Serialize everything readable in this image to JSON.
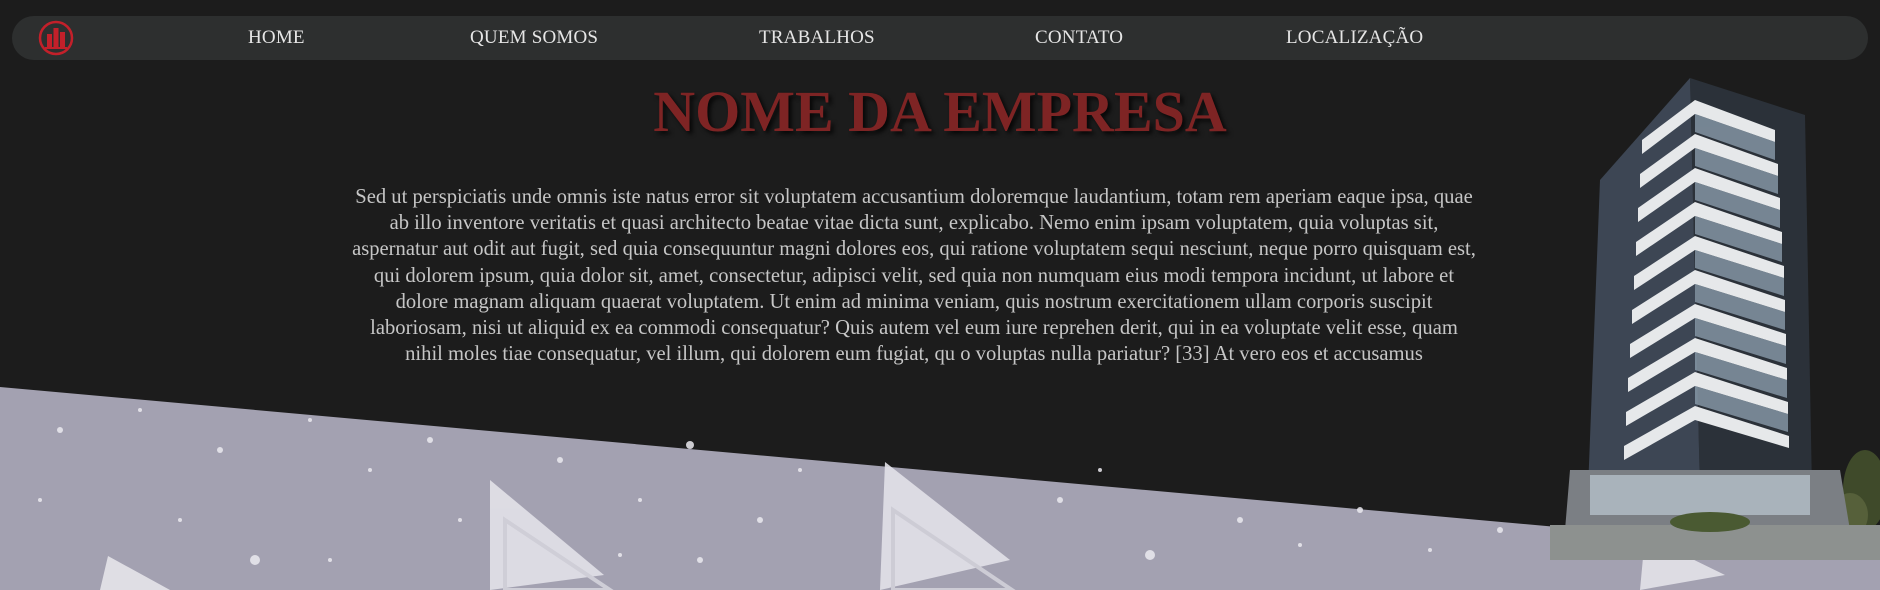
{
  "nav": {
    "logo_icon": "company-logo-icon",
    "items": [
      {
        "label": "HOME"
      },
      {
        "label": "QUEM SOMOS"
      },
      {
        "label": "TRABALHOS"
      },
      {
        "label": "CONTATO"
      },
      {
        "label": "LOCALIZAÇÃO"
      }
    ]
  },
  "hero": {
    "title": "NOME DA EMPRESA",
    "paragraph": "Sed ut perspiciatis unde omnis iste natus error sit voluptatem accusantium doloremque laudantium, totam rem aperiam eaque ipsa, quae ab illo inventore veritatis et quasi architecto beatae vitae dicta sunt, explicabo. Nemo enim ipsam voluptatem, quia voluptas sit, aspernatur aut odit aut fugit, sed quia consequuntur magni dolores eos, qui ratione voluptatem sequi nesciunt, neque porro quisquam est, qui dolorem ipsum, quia dolor sit, amet, consectetur, adipisci velit, sed quia non numquam eius modi tempora incidunt, ut labore et dolore magnam aliquam quaerat voluptatem. Ut enim ad minima veniam, quis nostrum exercitationem ullam corporis suscipit laboriosam, nisi ut aliquid ex ea commodi consequatur? Quis autem vel eum iure reprehen derit, qui in ea voluptate velit esse, quam nihil moles tiae consequatur, vel illum, qui dolorem eum fugiat, qu o voluptas nulla pariatur? [33] At vero eos et accusamus"
  },
  "colors": {
    "page_background": "#1c1c1c",
    "navbar_background": "#2d2f2f",
    "title_red": "#7e2424",
    "accent_red": "#c3202a",
    "lavender_band": "#a3a1b1"
  },
  "images": {
    "background": "triangle-pattern-background",
    "building": "apartment-building-image"
  }
}
